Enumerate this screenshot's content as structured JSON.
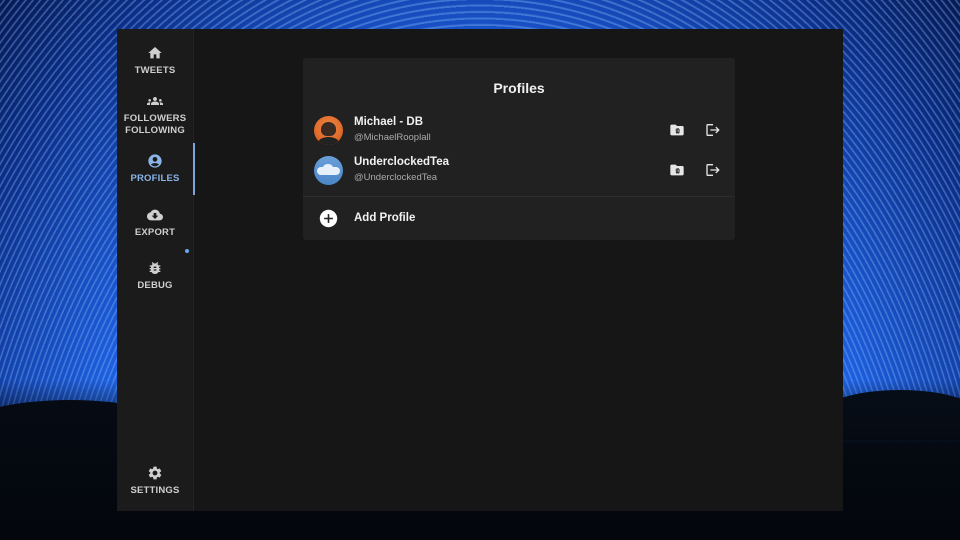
{
  "sidebar": {
    "items": [
      {
        "label": "TWEETS",
        "icon": "home-icon"
      },
      {
        "label": "FOLLOWERS\nFOLLOWING",
        "icon": "people-icon"
      },
      {
        "label": "PROFILES",
        "icon": "account-circle-icon",
        "active": true
      },
      {
        "label": "EXPORT",
        "icon": "cloud-download-icon",
        "badge": true
      },
      {
        "label": "DEBUG",
        "icon": "bug-icon"
      }
    ],
    "settings": {
      "label": "SETTINGS",
      "icon": "gear-icon"
    }
  },
  "profiles_card": {
    "title": "Profiles",
    "profiles": [
      {
        "name": "Michael - DB",
        "handle": "@MichaelRooplall"
      },
      {
        "name": "UnderclockedTea",
        "handle": "@UnderclockedTea"
      }
    ],
    "add_label": "Add Profile"
  },
  "colors": {
    "accent": "#8ab4e8",
    "window_bg": "#161616",
    "sidebar_bg": "#1b1b1b",
    "card_bg": "#212121"
  }
}
